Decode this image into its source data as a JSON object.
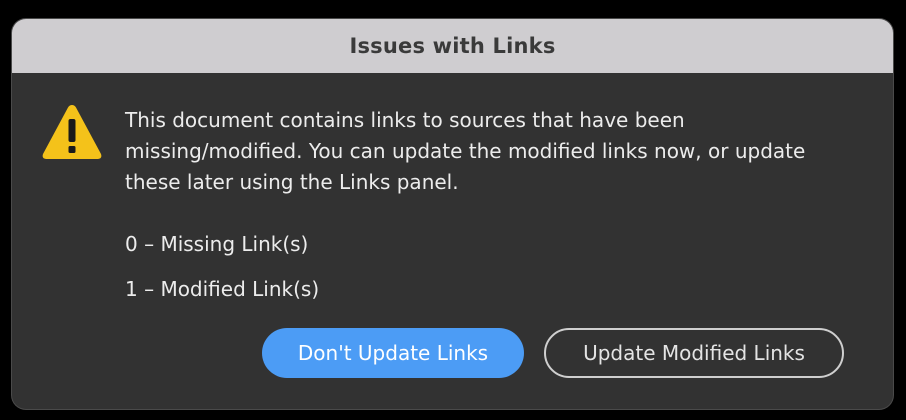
{
  "dialog": {
    "title": "Issues with Links",
    "icon": "warning-triangle-icon",
    "message": "This document contains links to sources that have been missing/modified. You can update the modified links now, or update these later using the Links panel.",
    "missing_count_text": "0 – Missing Link(s)",
    "modified_count_text": "1 – Modified Link(s)",
    "buttons": {
      "dont_update_label": "Don't Update Links",
      "update_label": "Update Modified Links"
    }
  },
  "colors": {
    "primary_button": "#4c9cf5",
    "warning": "#f4c21a",
    "dialog_bg": "#323232",
    "titlebar_bg": "#cfcdd0"
  }
}
